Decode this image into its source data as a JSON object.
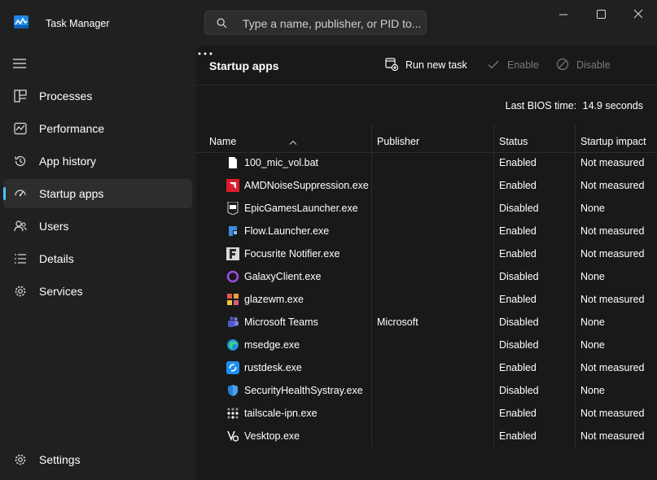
{
  "window": {
    "title": "Task Manager",
    "search_placeholder": "Type a name, publisher, or PID to..."
  },
  "sidebar": {
    "items": [
      {
        "label": "Processes",
        "icon": "processes-icon"
      },
      {
        "label": "Performance",
        "icon": "performance-icon"
      },
      {
        "label": "App history",
        "icon": "app-history-icon"
      },
      {
        "label": "Startup apps",
        "icon": "startup-apps-icon",
        "active": true
      },
      {
        "label": "Users",
        "icon": "users-icon"
      },
      {
        "label": "Details",
        "icon": "details-icon"
      },
      {
        "label": "Services",
        "icon": "services-icon"
      }
    ],
    "settings_label": "Settings"
  },
  "toolbar": {
    "page_title": "Startup apps",
    "run_new_task": "Run new task",
    "enable": "Enable",
    "disable": "Disable"
  },
  "bios": {
    "label": "Last BIOS time:",
    "value": "14.9 seconds"
  },
  "table": {
    "columns": [
      "Name",
      "Publisher",
      "Status",
      "Startup impact"
    ],
    "rows": [
      {
        "name": "100_mic_vol.bat",
        "publisher": "",
        "status": "Enabled",
        "impact": "Not measured",
        "icon": "file-icon"
      },
      {
        "name": "AMDNoiseSuppression.exe",
        "publisher": "",
        "status": "Enabled",
        "impact": "Not measured",
        "icon": "amd-icon"
      },
      {
        "name": "EpicGamesLauncher.exe",
        "publisher": "",
        "status": "Disabled",
        "impact": "None",
        "icon": "epic-icon"
      },
      {
        "name": "Flow.Launcher.exe",
        "publisher": "",
        "status": "Enabled",
        "impact": "Not measured",
        "icon": "flow-launcher-icon"
      },
      {
        "name": "Focusrite Notifier.exe",
        "publisher": "",
        "status": "Enabled",
        "impact": "Not measured",
        "icon": "focusrite-icon"
      },
      {
        "name": "GalaxyClient.exe",
        "publisher": "",
        "status": "Disabled",
        "impact": "None",
        "icon": "galaxy-icon"
      },
      {
        "name": "glazewm.exe",
        "publisher": "",
        "status": "Enabled",
        "impact": "Not measured",
        "icon": "glazewm-icon"
      },
      {
        "name": "Microsoft Teams",
        "publisher": "Microsoft",
        "status": "Disabled",
        "impact": "None",
        "icon": "teams-icon"
      },
      {
        "name": "msedge.exe",
        "publisher": "",
        "status": "Disabled",
        "impact": "None",
        "icon": "edge-icon"
      },
      {
        "name": "rustdesk.exe",
        "publisher": "",
        "status": "Enabled",
        "impact": "Not measured",
        "icon": "rustdesk-icon"
      },
      {
        "name": "SecurityHealthSystray.exe",
        "publisher": "",
        "status": "Disabled",
        "impact": "None",
        "icon": "shield-icon"
      },
      {
        "name": "tailscale-ipn.exe",
        "publisher": "",
        "status": "Enabled",
        "impact": "Not measured",
        "icon": "tailscale-icon"
      },
      {
        "name": "Vesktop.exe",
        "publisher": "",
        "status": "Enabled",
        "impact": "Not measured",
        "icon": "vesktop-icon"
      }
    ]
  },
  "colors": {
    "accent": "#4cc2ff",
    "background": "#202020",
    "panel": "#191919"
  }
}
